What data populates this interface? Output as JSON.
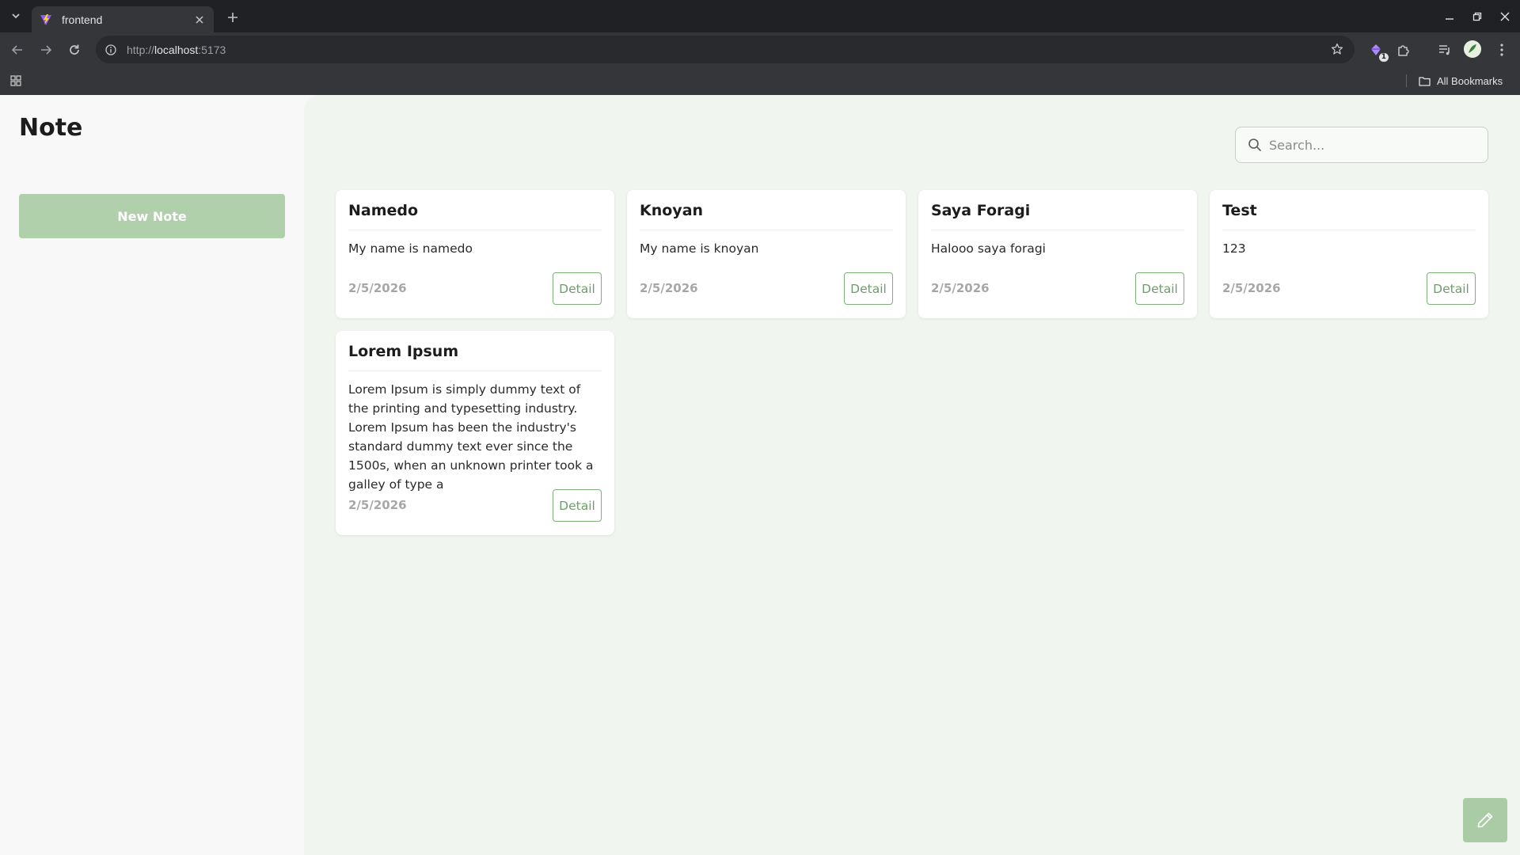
{
  "browser": {
    "tab_title": "frontend",
    "url_scheme": "http://",
    "url_host": "localhost",
    "url_port": ":5173",
    "extension_badge": "1",
    "bookmarks_label": "All Bookmarks"
  },
  "sidebar": {
    "title": "Note",
    "new_note_label": "New Note"
  },
  "search": {
    "placeholder": "Search..."
  },
  "notes": [
    {
      "title": "Namedo",
      "body": "My name is namedo",
      "date": "2/5/2026",
      "action": "Detail"
    },
    {
      "title": "Knoyan",
      "body": "My name is knoyan",
      "date": "2/5/2026",
      "action": "Detail"
    },
    {
      "title": "Saya Foragi",
      "body": "Halooo saya foragi",
      "date": "2/5/2026",
      "action": "Detail"
    },
    {
      "title": "Test",
      "body": "123",
      "date": "2/5/2026",
      "action": "Detail"
    },
    {
      "title": "Lorem Ipsum",
      "body": "Lorem Ipsum is simply dummy text of the printing and typesetting industry. Lorem Ipsum has been the industry's standard dummy text ever since the 1500s, when an unknown printer took a galley of type a",
      "date": "2/5/2026",
      "action": "Detail"
    }
  ],
  "colors": {
    "accent": "#6aa165",
    "new_note_bg": "#b0cfab",
    "main_bg": "#f0f5ef",
    "sidebar_bg": "#f7f8f7"
  },
  "icons": {
    "fab": "pencil-icon",
    "search": "search-icon"
  }
}
